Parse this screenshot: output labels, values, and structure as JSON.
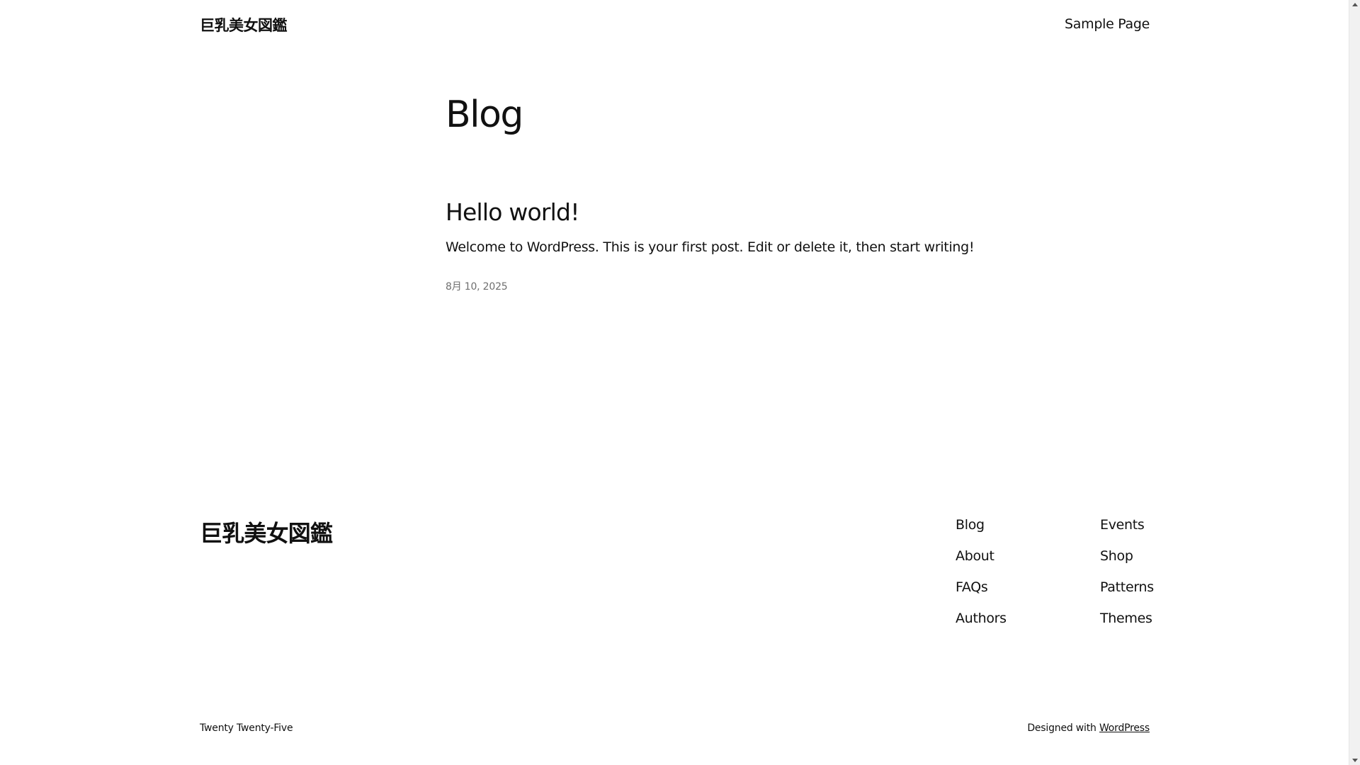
{
  "header": {
    "site_title": "巨乳美女図鑑",
    "nav": [
      {
        "label": "Sample Page"
      }
    ]
  },
  "main": {
    "page_heading": "Blog",
    "posts": [
      {
        "title": "Hello world!",
        "excerpt": "Welcome to WordPress. This is your first post. Edit or delete it, then start writing!",
        "date": "8月 10, 2025"
      }
    ]
  },
  "footer": {
    "site_title": "巨乳美女図鑑",
    "nav_col_1": [
      {
        "label": "Blog"
      },
      {
        "label": "About"
      },
      {
        "label": "FAQs"
      },
      {
        "label": "Authors"
      }
    ],
    "nav_col_2": [
      {
        "label": "Events"
      },
      {
        "label": "Shop"
      },
      {
        "label": "Patterns"
      },
      {
        "label": "Themes"
      }
    ],
    "theme_credit": "Twenty Twenty-Five",
    "designed_with_prefix": "Designed with",
    "designed_with_link": "WordPress"
  }
}
